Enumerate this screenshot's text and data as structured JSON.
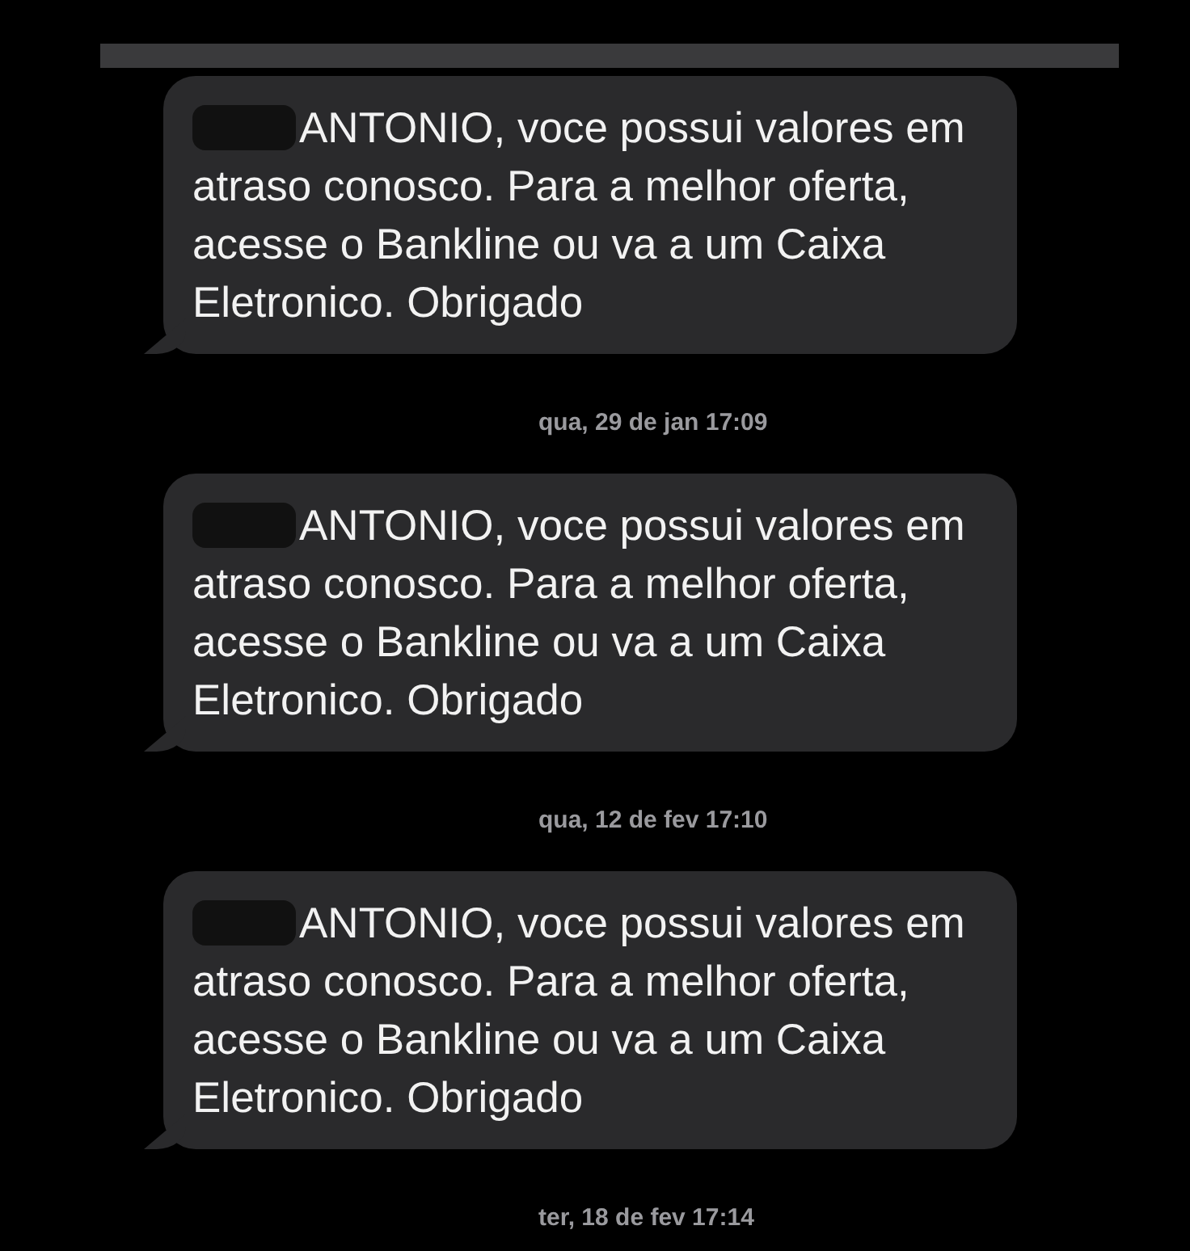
{
  "messages": [
    {
      "text": "ANTONIO, voce possui valores em atraso conosco. Para a melhor oferta, acesse o Bankline ou va a um Caixa Eletronico. Obrigado",
      "redacted": true,
      "timestamp": "qua, 29 de jan 17:09"
    },
    {
      "text": "ANTONIO, voce possui valores em atraso conosco. Para a melhor oferta, acesse o Bankline ou va a um Caixa Eletronico. Obrigado",
      "redacted": true,
      "timestamp": "qua, 12 de fev 17:10"
    },
    {
      "text": "ANTONIO, voce possui valores em atraso conosco. Para a melhor oferta, acesse o Bankline ou va a um Caixa Eletronico. Obrigado",
      "redacted": true,
      "timestamp": "ter, 18 de fev 17:14"
    }
  ]
}
